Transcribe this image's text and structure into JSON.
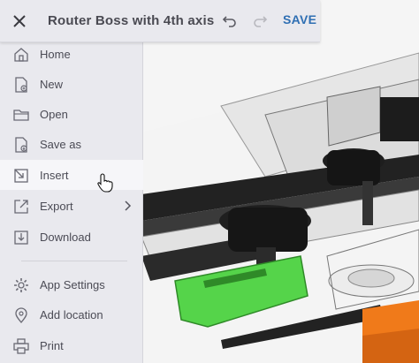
{
  "header": {
    "close_icon": "close-icon",
    "title": "Router Boss with 4th axis",
    "undo_icon": "undo-icon",
    "redo_icon": "redo-icon",
    "save_label": "SAVE"
  },
  "menu": {
    "items": [
      {
        "label": "Home",
        "icon": "home-icon"
      },
      {
        "label": "New",
        "icon": "new-file-icon"
      },
      {
        "label": "Open",
        "icon": "folder-icon"
      },
      {
        "label": "Save as",
        "icon": "save-as-icon"
      },
      {
        "label": "Insert",
        "icon": "insert-icon",
        "hovered": true
      },
      {
        "label": "Export",
        "icon": "export-icon",
        "has_submenu": true
      },
      {
        "label": "Download",
        "icon": "download-icon"
      },
      {
        "label": "App Settings",
        "icon": "gear-icon"
      },
      {
        "label": "Add location",
        "icon": "location-pin-icon"
      },
      {
        "label": "Print",
        "icon": "printer-icon"
      }
    ]
  },
  "colors": {
    "accent": "#2f6fb3",
    "menu_bg": "#e9e9ee",
    "hover_bg": "#f6f6f9",
    "text": "#4b4b55"
  }
}
